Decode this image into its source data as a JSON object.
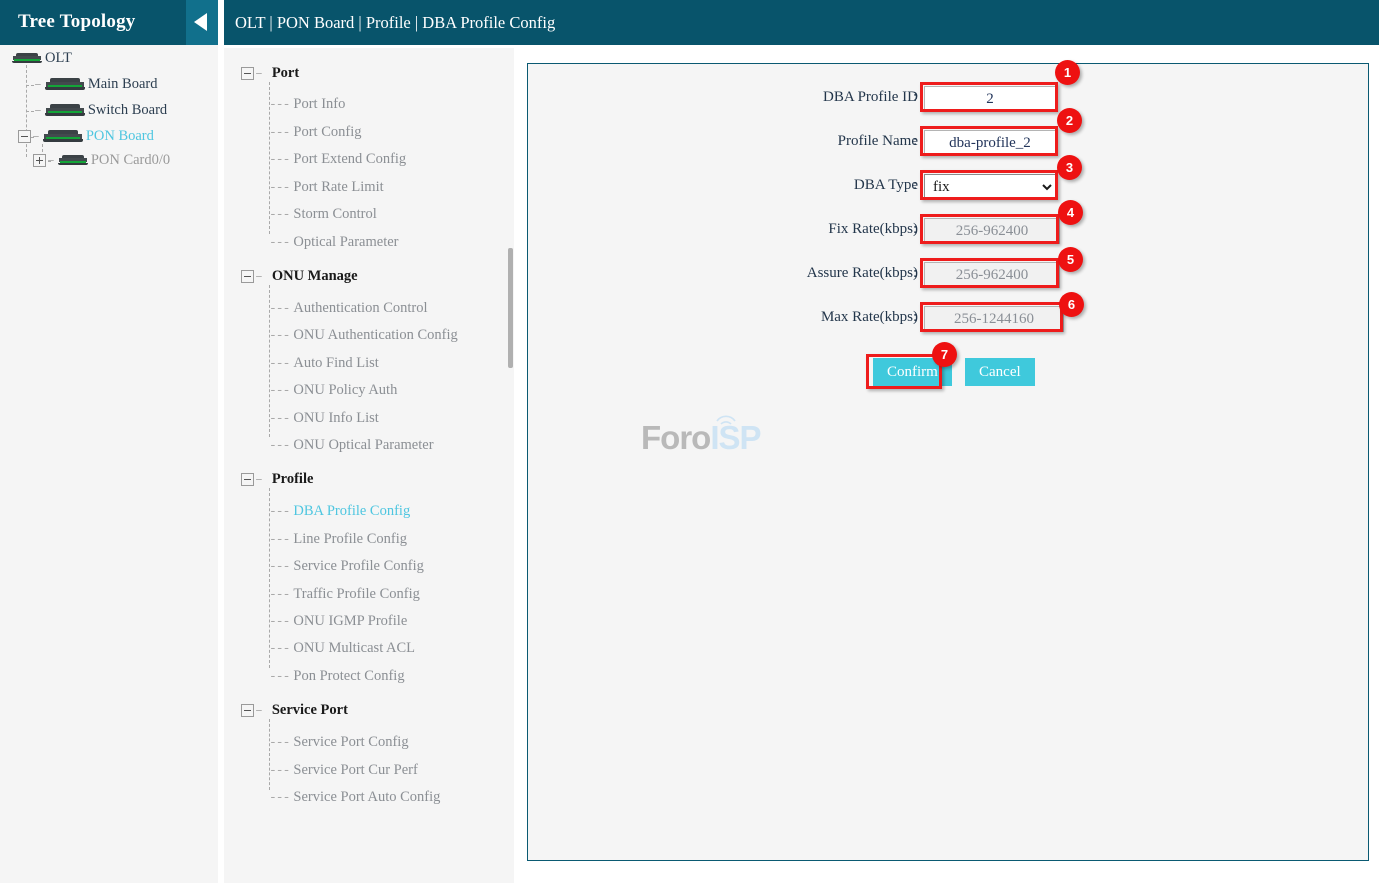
{
  "sidebar": {
    "title": "Tree Topology",
    "collapse_icon": "triangle-left-icon",
    "tree": [
      {
        "label": "OLT",
        "icon": "device-icon",
        "state": "normal",
        "expander": null
      },
      {
        "label": "Main Board",
        "icon": "device-icon",
        "state": "normal",
        "expander": null
      },
      {
        "label": "Switch Board",
        "icon": "device-icon",
        "state": "normal",
        "expander": null
      },
      {
        "label": "PON Board",
        "icon": "device-icon",
        "state": "selected",
        "expander": "minus"
      },
      {
        "label": "PON Card0/0",
        "icon": "device-icon",
        "state": "muted",
        "expander": "plus"
      }
    ]
  },
  "header": {
    "breadcrumb": "OLT | PON Board | Profile | DBA Profile Config"
  },
  "nav": {
    "groups": [
      {
        "label": "Port",
        "expander": "minus",
        "items": [
          {
            "label": "Port Info",
            "active": false
          },
          {
            "label": "Port Config",
            "active": false
          },
          {
            "label": "Port Extend Config",
            "active": false
          },
          {
            "label": "Port Rate Limit",
            "active": false
          },
          {
            "label": "Storm Control",
            "active": false
          },
          {
            "label": "Optical Parameter",
            "active": false
          }
        ]
      },
      {
        "label": "ONU Manage",
        "expander": "minus",
        "items": [
          {
            "label": "Authentication Control",
            "active": false
          },
          {
            "label": "ONU Authentication Config",
            "active": false
          },
          {
            "label": "Auto Find List",
            "active": false
          },
          {
            "label": "ONU Policy Auth",
            "active": false
          },
          {
            "label": "ONU Info List",
            "active": false
          },
          {
            "label": "ONU Optical Parameter",
            "active": false
          }
        ]
      },
      {
        "label": "Profile",
        "expander": "minus",
        "items": [
          {
            "label": "DBA Profile Config",
            "active": true
          },
          {
            "label": "Line Profile Config",
            "active": false
          },
          {
            "label": "Service Profile Config",
            "active": false
          },
          {
            "label": "Traffic Profile Config",
            "active": false
          },
          {
            "label": "ONU IGMP Profile",
            "active": false
          },
          {
            "label": "ONU Multicast ACL",
            "active": false
          },
          {
            "label": "Pon Protect Config",
            "active": false
          }
        ]
      },
      {
        "label": "Service Port",
        "expander": "minus",
        "items": [
          {
            "label": "Service Port Config",
            "active": false
          },
          {
            "label": "Service Port Cur Perf",
            "active": false
          },
          {
            "label": "Service Port Auto Config",
            "active": false
          }
        ]
      }
    ]
  },
  "form": {
    "fields": [
      {
        "label": "DBA Profile ID",
        "colon": ":",
        "type": "text",
        "value": "2",
        "placeholder": "",
        "readonly": false
      },
      {
        "label": "Profile Name",
        "colon": ":",
        "type": "text",
        "value": "dba-profile_2",
        "placeholder": "",
        "readonly": false
      },
      {
        "label": "DBA Type",
        "colon": ":",
        "type": "select",
        "value": "fix",
        "options": [
          "fix"
        ],
        "readonly": false
      },
      {
        "label": "Fix Rate(kbps)",
        "colon": ":",
        "type": "text",
        "value": "",
        "placeholder": "256-962400",
        "readonly": true
      },
      {
        "label": "Assure Rate(kbps)",
        "colon": ":",
        "type": "text",
        "value": "",
        "placeholder": "256-962400",
        "readonly": true
      },
      {
        "label": "Max Rate(kbps)",
        "colon": ":",
        "type": "text",
        "value": "",
        "placeholder": "256-1244160",
        "readonly": true
      }
    ],
    "confirm_label": "Confirm",
    "cancel_label": "Cancel"
  },
  "annotations": {
    "badges": [
      "1",
      "2",
      "3",
      "4",
      "5",
      "6",
      "7"
    ],
    "color": "#ee1111"
  },
  "watermark": {
    "part1": "Foro",
    "part2": "ISP"
  },
  "colors": {
    "header_bg": "#08546b",
    "collapse_bg": "#11708c",
    "panel_bg": "#f5f5f5",
    "accent_cyan": "#4ec6e0",
    "button_bg": "#3fc9dc",
    "annotation_red": "#ee1c1c",
    "led_green": "#13a538"
  }
}
